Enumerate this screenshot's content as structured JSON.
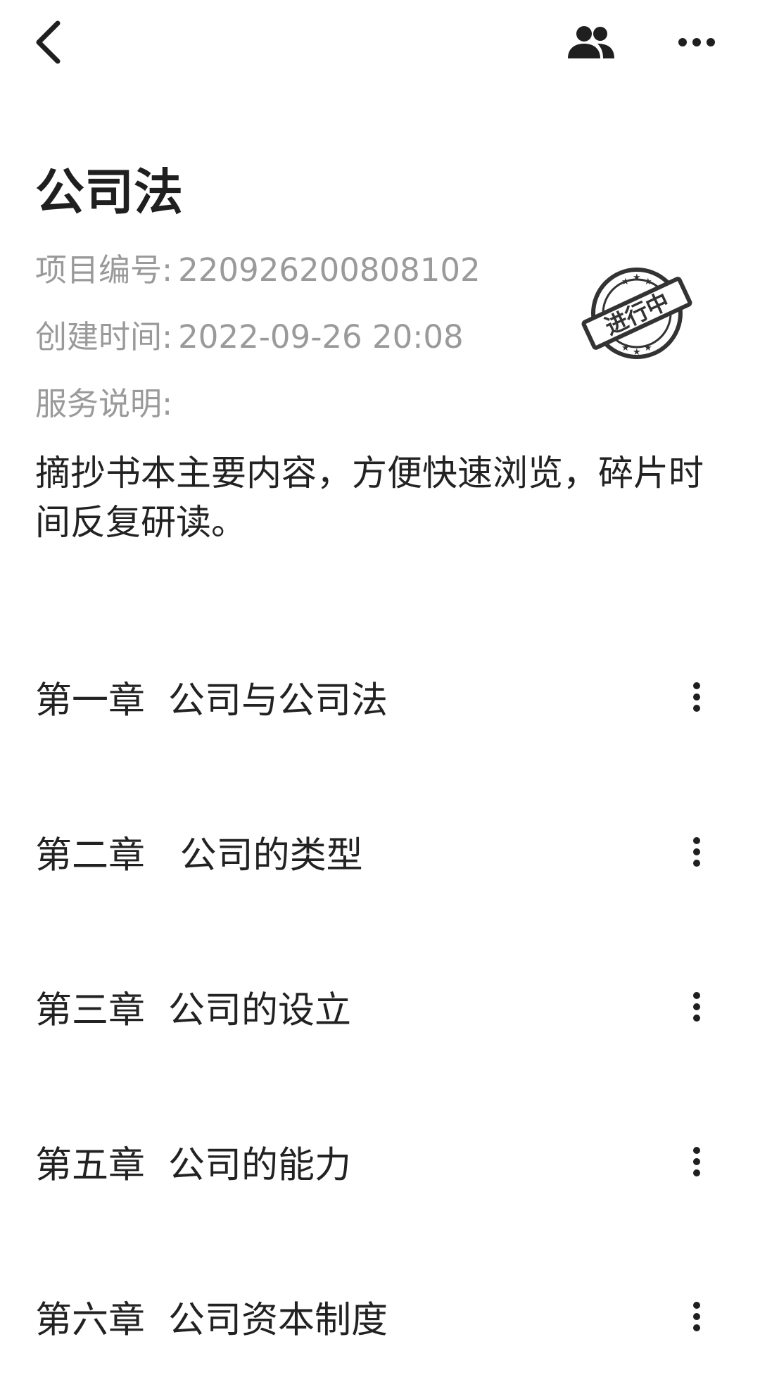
{
  "header": {
    "back_icon": "chevron-left-icon",
    "members_icon": "people-icon",
    "more_icon": "more-horizontal-icon"
  },
  "project": {
    "title": "公司法",
    "id_label": "项目编号:",
    "id_value": "220926200808102",
    "created_label": "创建时间:",
    "created_value": "2022-09-26 20:08",
    "desc_label": "服务说明:",
    "description": "摘抄书本主要内容，方便快速浏览，碎片时间反复研读。",
    "status_stamp": "进行中"
  },
  "chapters": [
    {
      "title": "第一章  公司与公司法"
    },
    {
      "title": "第二章   公司的类型"
    },
    {
      "title": "第三章  公司的设立"
    },
    {
      "title": "第五章  公司的能力"
    },
    {
      "title": "第六章  公司资本制度"
    }
  ],
  "colors": {
    "text_primary": "#222222",
    "text_secondary": "#9a9a9a",
    "icon": "#1f1f1f",
    "stamp": "#333333"
  }
}
